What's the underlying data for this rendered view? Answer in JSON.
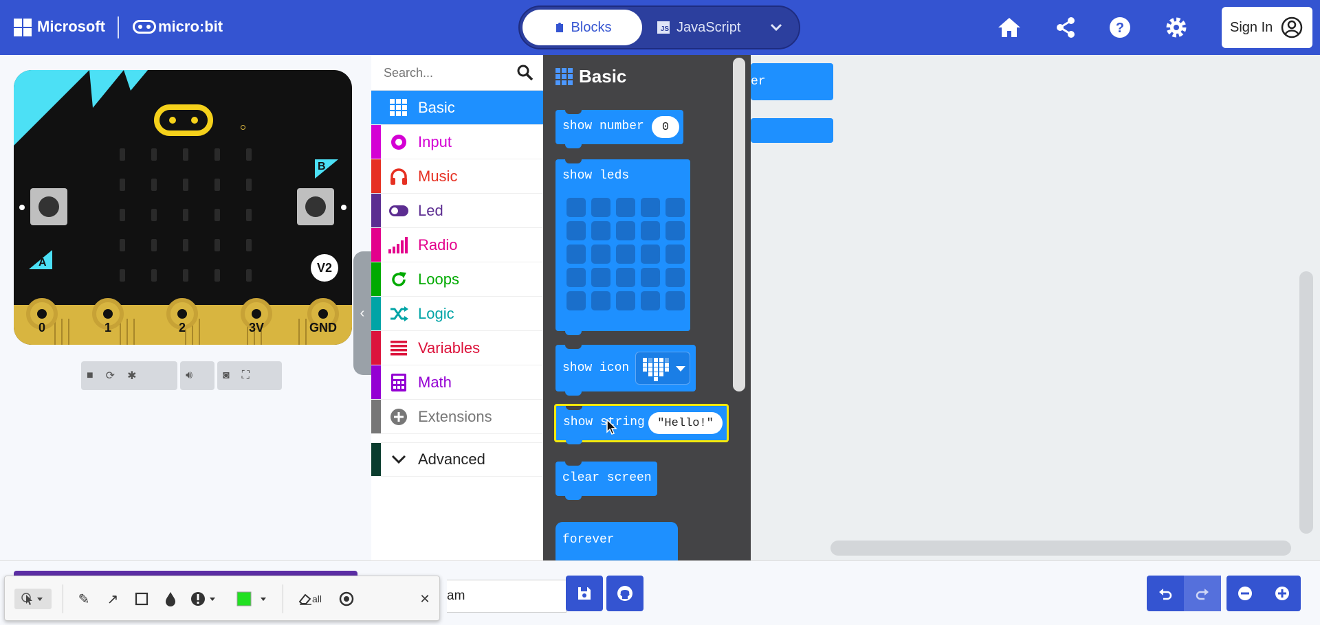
{
  "header": {
    "brand": "Microsoft",
    "product": "micro:bit",
    "mode_blocks": "Blocks",
    "mode_js": "JavaScript",
    "js_badge": "JS",
    "sign_in": "Sign In"
  },
  "simulator": {
    "pins": [
      "0",
      "1",
      "2",
      "3V",
      "GND"
    ],
    "button_a": "A",
    "button_b": "B",
    "version_badge": "V2"
  },
  "toolbox": {
    "search_placeholder": "Search...",
    "categories": [
      {
        "label": "Basic",
        "color": "#1e90ff"
      },
      {
        "label": "Input",
        "color": "#d400d4"
      },
      {
        "label": "Music",
        "color": "#e63022"
      },
      {
        "label": "Led",
        "color": "#5c2d91"
      },
      {
        "label": "Radio",
        "color": "#e3008c"
      },
      {
        "label": "Loops",
        "color": "#00aa00"
      },
      {
        "label": "Logic",
        "color": "#00a4a6"
      },
      {
        "label": "Variables",
        "color": "#dc143c"
      },
      {
        "label": "Math",
        "color": "#9400d3"
      },
      {
        "label": "Extensions",
        "color": "#777777"
      },
      {
        "label": "Advanced",
        "color": "#0b3d2e"
      }
    ]
  },
  "flyout": {
    "title": "Basic",
    "blocks": {
      "show_number": "show number",
      "show_number_value": "0",
      "show_leds": "show leds",
      "show_icon": "show icon",
      "show_string": "show string",
      "show_string_value": "\"Hello!\"",
      "clear_screen": "clear screen",
      "forever": "forever"
    }
  },
  "workspace": {
    "partial_block_text": "er"
  },
  "bottom": {
    "project_name": "am",
    "erase_all": "all"
  },
  "colors": {
    "header_bg": "#3454d1",
    "block_blue": "#1e90ff",
    "flyout_bg": "#444446",
    "highlight": "#f5e90a"
  }
}
